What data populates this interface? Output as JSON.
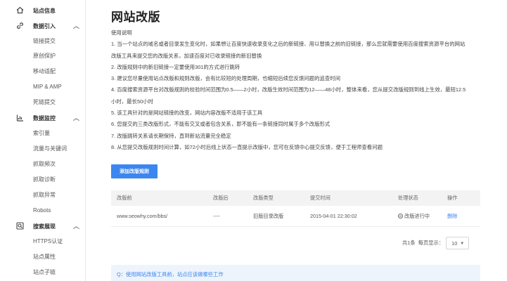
{
  "sidebar": {
    "sections": [
      {
        "label": "站点信息",
        "icon": "home-icon",
        "expandable": false
      },
      {
        "label": "数据引入",
        "icon": "link-icon",
        "chevron": "︿",
        "items": [
          "链接提交",
          "原创保护",
          "移动适配",
          "MIP & AMP",
          "死链提交"
        ]
      },
      {
        "label": "数据监控",
        "icon": "chart-icon",
        "chevron": "︿",
        "items": [
          "索引量",
          "流量与关键词",
          "抓取频次",
          "抓取诊断",
          "抓取异常",
          "Robots"
        ]
      },
      {
        "label": "搜索展现",
        "icon": "search-icon",
        "chevron": "︿",
        "items": [
          "HTTPS认证",
          "站点属性",
          "站点子链"
        ]
      }
    ]
  },
  "main": {
    "title": "网站改版",
    "instructions": [
      "使用说明",
      "1. 当一个站点的域名或者目录发生变化时，如果想让百度快速收录变化之后的新链接、用以替换之前的旧链接，那么您就需要使用百度搜索资源平台的网站",
      "改版工具来提交您的改版关系，加速百度对已收录链接的新旧替换",
      "2. 改版规则中的新旧链接一定要使用301的方式进行跳转",
      "3. 建议您尽量使用站点改版和规则改版，会有比较短的处理周期，也缩短后续您反馈问题的追查时间",
      "4. 百度搜索资源平台对改版规则的校验时间范围为0.5——2小时，改版生效时间范围为12——48小时，整体来看，您从提交改版规则到线上生效，最短12.5",
      "小时，最长50小时",
      "5. 该工具针对的是网站链接的改变，网站内容改版不适用于该工具",
      "6. 您提交的三类改版形式，不能有交叉或者包含关系，即不能有一条链接同时属于多个改版形式",
      "7. 改版跳转关系请长期保持，直到新站流量完全稳定",
      "8. 从您提交改版规则时间计算，如72小时后线上状态一直提示改版中，您可在反馈中心提交反馈，便于工程师查看问题"
    ],
    "add_button": "添加改版规则",
    "table": {
      "headers": [
        "改版前",
        "改版后",
        "改版类型",
        "提交时间",
        "处理状态",
        "操作"
      ],
      "rows": [
        {
          "before": "www.seowhy.com/bbs/",
          "after": "----",
          "type": "旧版目录改版",
          "time": "2015-04-01 22:30:02",
          "status": "改版进行中",
          "action": "删除"
        }
      ]
    },
    "pager": {
      "total": "共1条",
      "per_page_label": "每页显示：",
      "per_page_value": "10"
    },
    "faq": "Q：使用网站改版工具前，站点应该做哪些工作"
  },
  "colors": {
    "accent": "#3b86f0",
    "faq_bg": "#eef4fc",
    "header_bg": "#f3f3f3"
  }
}
